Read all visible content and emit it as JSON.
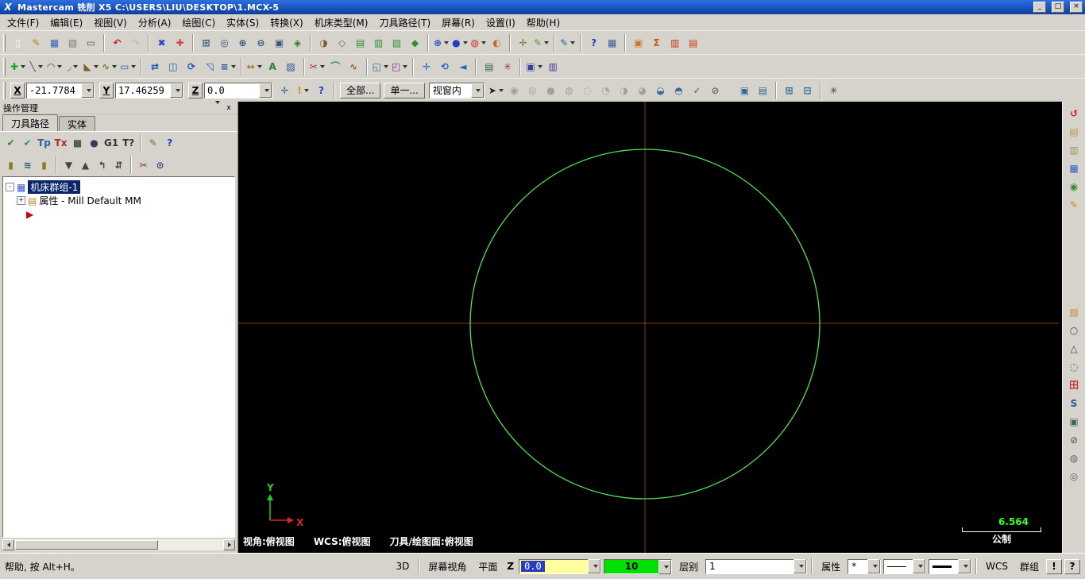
{
  "window": {
    "icon_glyph": "X",
    "title": "Mastercam 铣削 X5  C:\\USERS\\LIU\\DESKTOP\\1.MCX-5",
    "controls": {
      "minimize": "_",
      "maximize": "□",
      "close": "×"
    }
  },
  "menu": {
    "items": [
      "文件(F)",
      "编辑(E)",
      "视图(V)",
      "分析(A)",
      "绘图(C)",
      "实体(S)",
      "转换(X)",
      "机床类型(M)",
      "刀具路径(T)",
      "屏幕(R)",
      "设置(I)",
      "帮助(H)"
    ]
  },
  "toolbar_row1": [
    {
      "n": "new-file",
      "g": "▯",
      "c": "#f8f8f8"
    },
    {
      "n": "sketch",
      "g": "✎",
      "c": "#b8860b"
    },
    {
      "n": "save-file",
      "g": "▦",
      "c": "#2f5fbf"
    },
    {
      "n": "file-merge",
      "g": "▧",
      "c": "#7a7a7a"
    },
    {
      "n": "print",
      "g": "▭",
      "c": "#606060"
    },
    {
      "sep": true
    },
    {
      "n": "undo",
      "g": "↶",
      "c": "#cc2222"
    },
    {
      "n": "redo",
      "g": "↷",
      "c": "#cc8888",
      "x": true
    },
    {
      "sep": true
    },
    {
      "n": "delete-entities",
      "g": "✖",
      "c": "#2244cc"
    },
    {
      "n": "undelete",
      "g": "✚",
      "c": "#cc4444"
    },
    {
      "sep": true
    },
    {
      "n": "zoom-window",
      "g": "⊞",
      "c": "#33557f"
    },
    {
      "n": "zoom-target",
      "g": "◎",
      "c": "#33557f"
    },
    {
      "n": "zoom-in",
      "g": "⊕",
      "c": "#33557f"
    },
    {
      "n": "zoom-out",
      "g": "⊖",
      "c": "#33557f"
    },
    {
      "n": "zoom-fit",
      "g": "▣",
      "c": "#33557f"
    },
    {
      "n": "repaint",
      "g": "◈",
      "c": "#2f7f2f"
    },
    {
      "sep": true
    },
    {
      "n": "gview-shaded",
      "g": "◑",
      "c": "#7f5f2f"
    },
    {
      "n": "gview-wireframe",
      "g": "◇",
      "c": "#7f5f2f"
    },
    {
      "n": "gview-top",
      "g": "▤",
      "c": "#2f8f2f"
    },
    {
      "n": "gview-front",
      "g": "▥",
      "c": "#2f8f2f"
    },
    {
      "n": "gview-side",
      "g": "▨",
      "c": "#2f8f2f"
    },
    {
      "n": "gview-iso",
      "g": "◆",
      "c": "#2f8f2f"
    },
    {
      "sep": true
    },
    {
      "n": "wcs-sphere",
      "g": "⊕",
      "c": "#2255cc",
      "d": true
    },
    {
      "n": "shading-mode",
      "g": "●",
      "c": "#1f3fbf",
      "d": true
    },
    {
      "n": "material-render",
      "g": "◍",
      "c": "#cc3333",
      "d": true
    },
    {
      "n": "translucency",
      "g": "◐",
      "c": "#cc6633"
    },
    {
      "sep": true
    },
    {
      "n": "analyze-position",
      "g": "✛",
      "c": "#8a6a2a"
    },
    {
      "n": "analyze-dynamic",
      "g": "✎",
      "c": "#5a9a2a",
      "d": true
    },
    {
      "sep": true
    },
    {
      "n": "analyze-distance",
      "g": "✎",
      "c": "#2a6a9a",
      "d": true
    },
    {
      "sep": true
    },
    {
      "n": "help",
      "g": "?",
      "c": "#1f3fbf"
    },
    {
      "n": "grid-settings",
      "g": "▦",
      "c": "#3a5a9a"
    },
    {
      "sep": true
    },
    {
      "n": "mcx-convert",
      "g": "▣",
      "c": "#cc7722"
    },
    {
      "n": "summary",
      "g": "Σ",
      "c": "#cc5511"
    },
    {
      "n": "net-collaborate",
      "g": "▥",
      "c": "#cc3311"
    },
    {
      "n": "screen-capture",
      "g": "▤",
      "c": "#cc3311"
    }
  ],
  "toolbar_row2": [
    {
      "n": "create-point",
      "g": "✚",
      "c": "#1f9f1f",
      "d": true
    },
    {
      "n": "create-line",
      "g": "╲",
      "c": "#33557f",
      "d": true
    },
    {
      "n": "create-arc",
      "g": "◠",
      "c": "#7f337f",
      "d": true
    },
    {
      "n": "create-fillet",
      "g": "◞",
      "c": "#2f7f7f",
      "d": true
    },
    {
      "n": "create-chamfer",
      "g": "◣",
      "c": "#7f5f2f",
      "d": true
    },
    {
      "n": "create-spline",
      "g": "∿",
      "c": "#5f7f2f",
      "d": true
    },
    {
      "n": "create-rectangle",
      "g": "▭",
      "c": "#2f5f9f",
      "d": true
    },
    {
      "sep": true
    },
    {
      "n": "xform-translate",
      "g": "⇄",
      "c": "#2255aa"
    },
    {
      "n": "xform-mirror",
      "g": "◫",
      "c": "#2255aa"
    },
    {
      "n": "xform-rotate",
      "g": "⟳",
      "c": "#2255aa"
    },
    {
      "n": "xform-scale",
      "g": "◹",
      "c": "#2255aa"
    },
    {
      "n": "xform-offset",
      "g": "≡",
      "c": "#2255aa",
      "d": true
    },
    {
      "sep": true
    },
    {
      "n": "dimension-smart",
      "g": "↔",
      "c": "#9a7a2a",
      "d": true
    },
    {
      "n": "drafting-note",
      "g": "A",
      "c": "#2f7f2f"
    },
    {
      "n": "hatch",
      "g": "▨",
      "c": "#3a4a9a"
    },
    {
      "sep": true
    },
    {
      "n": "trim-break",
      "g": "✂",
      "c": "#aa3333",
      "d": true
    },
    {
      "n": "join-entities",
      "g": "⌒",
      "c": "#2f8f5f"
    },
    {
      "n": "modify-spline",
      "g": "∿",
      "c": "#8f5f2f"
    },
    {
      "sep": true
    },
    {
      "n": "surface-create",
      "g": "◱",
      "c": "#2f6f8f",
      "d": true
    },
    {
      "n": "solid-extrude",
      "g": "◰",
      "c": "#6f2f8f",
      "d": true
    },
    {
      "sep": true
    },
    {
      "n": "view-pan",
      "g": "✛",
      "c": "#2266cc"
    },
    {
      "n": "view-rotate",
      "g": "⟲",
      "c": "#2266cc"
    },
    {
      "n": "view-previous",
      "g": "◄",
      "c": "#2266cc"
    },
    {
      "sep": true
    },
    {
      "n": "levels-manager",
      "g": "▤",
      "c": "#3a6a3a"
    },
    {
      "n": "attributes-set",
      "g": "✳",
      "c": "#9a3a3a"
    },
    {
      "sep": true
    },
    {
      "n": "machine-group-tools",
      "g": "▣",
      "c": "#3a3a9a",
      "d": true
    },
    {
      "n": "toolpath-editor",
      "g": "▥",
      "c": "#3a3a9a"
    }
  ],
  "coord_bar": {
    "x_label": "X",
    "x_value": "-21.7784",
    "y_label": "Y",
    "y_value": "17.46259",
    "z_label": "Z",
    "z_value": "0.0",
    "icons_mid": [
      {
        "n": "fast-point",
        "g": "✛",
        "c": "#2f5f9f"
      },
      {
        "n": "autocursor-config",
        "g": "!",
        "c": "#cc9900",
        "d": true
      },
      {
        "n": "autocursor-help",
        "g": "?",
        "c": "#1f3fbf"
      }
    ],
    "all_button": "全部...",
    "single_button": "单一...",
    "select-cursor-glyph": "➤",
    "window_combo": "视窗内",
    "icons_select": [
      {
        "n": "general-selection",
        "g": "➤",
        "c": "#222222",
        "d": true
      },
      {
        "n": "quick-mask-points",
        "g": "◉",
        "c": "#555555",
        "x": true
      },
      {
        "n": "quick-mask-lines",
        "g": "◎",
        "c": "#555555",
        "x": true
      },
      {
        "n": "quick-mask-arcs",
        "g": "●",
        "c": "#555555",
        "x": true
      },
      {
        "n": "quick-mask-splines",
        "g": "◍",
        "c": "#555555",
        "x": true
      },
      {
        "n": "quick-mask-surfaces",
        "g": "◌",
        "c": "#555555",
        "x": true
      },
      {
        "n": "quick-mask-solids",
        "g": "◔",
        "c": "#555555",
        "x": true
      },
      {
        "n": "quick-mask-wireframe",
        "g": "◑",
        "c": "#555555",
        "x": true
      },
      {
        "n": "quick-mask-drafting",
        "g": "◕",
        "c": "#555555",
        "x": true
      },
      {
        "n": "quick-mask-color",
        "g": "◒",
        "c": "#3a6a9a"
      },
      {
        "n": "quick-mask-group",
        "g": "◓",
        "c": "#3a6a9a"
      },
      {
        "n": "quick-mask-result",
        "g": "✓",
        "c": "#2f7f2f"
      },
      {
        "n": "quick-mask-clear",
        "g": "⊘",
        "c": "#666666"
      }
    ],
    "icons_right": [
      {
        "n": "display-toolpaths",
        "g": "▣",
        "c": "#2a6a9a"
      },
      {
        "n": "display-wireframe",
        "g": "▤",
        "c": "#2a6a9a"
      },
      {
        "sep": true
      },
      {
        "n": "planes-select",
        "g": "⊞",
        "c": "#2a6a9a"
      },
      {
        "n": "z-depth-select",
        "g": "⊟",
        "c": "#2a6a9a"
      },
      {
        "sep": true
      },
      {
        "n": "axes-toggle",
        "g": "✳",
        "c": "#444444"
      }
    ]
  },
  "ops_manager": {
    "title": "操作管理",
    "tabs": [
      "刀具路径",
      "实体"
    ],
    "toolbar1": [
      {
        "n": "select-all-operations",
        "g": "✔",
        "c": "#2f8f2f"
      },
      {
        "n": "select-all-dirty",
        "g": "✔",
        "c": "#2f8f8f"
      },
      {
        "n": "regen-selected",
        "g": "Tp",
        "c": "#2f5f9f"
      },
      {
        "n": "regen-all-dirty",
        "g": "Tx",
        "c": "#9f2f2f"
      },
      {
        "n": "backplot",
        "g": "■",
        "c": "#5a5a5a"
      },
      {
        "n": "verify",
        "g": "●",
        "c": "#3a3a5a"
      },
      {
        "n": "post-process",
        "g": "G1",
        "c": "#333333"
      },
      {
        "n": "highfeed",
        "g": "T?",
        "c": "#333333"
      },
      {
        "sep": true
      },
      {
        "n": "edit-operations",
        "g": "✎",
        "c": "#8a6a2a"
      },
      {
        "n": "operations-help",
        "g": "?",
        "c": "#1f3fbf"
      }
    ],
    "toolbar2": [
      {
        "n": "lock-operations",
        "g": "▮",
        "c": "#8a7a2a"
      },
      {
        "n": "toggle-toolpath-display",
        "g": "≋",
        "c": "#2a5a8a"
      },
      {
        "n": "lock-posting",
        "g": "▮",
        "c": "#8a7a2a"
      },
      {
        "sep": true
      },
      {
        "n": "move-insert-down",
        "g": "▼",
        "c": "#444444"
      },
      {
        "n": "move-insert-up",
        "g": "▲",
        "c": "#444444"
      },
      {
        "n": "move-insert-arrow",
        "g": "↰",
        "c": "#444444"
      },
      {
        "n": "scroll-insert",
        "g": "⇵",
        "c": "#444444"
      },
      {
        "sep": true
      },
      {
        "n": "only-display-selected",
        "g": "✂",
        "c": "#8a3a3a"
      },
      {
        "n": "screen-toolpaths",
        "g": "⊙",
        "c": "#3a3a8a"
      }
    ],
    "tree": {
      "root_expander": "-",
      "root_label": "机床群组-1",
      "child_expander": "+",
      "child_label": "属性 - Mill Default MM",
      "insert_marker": "▶"
    }
  },
  "viewport": {
    "status": {
      "view": "视角:俯视图",
      "wcs": "WCS:俯视图",
      "cplane": "刀具/绘图面:俯视图"
    },
    "scale": {
      "value": "6.564",
      "unit": "公制"
    },
    "axis": {
      "x_label": "X",
      "y_label": "Y"
    },
    "colors": {
      "background": "#000000",
      "circle": "#55e055",
      "crosshair": "#8a3a12",
      "axis_x": "#dd2222",
      "axis_y": "#22cc22",
      "scale_text": "#33ff33"
    }
  },
  "right_toolbar": [
    {
      "n": "undo-last",
      "g": "↺",
      "c": "#cc2222"
    },
    {
      "n": "clipboard",
      "g": "▤",
      "c": "#b89a4a"
    },
    {
      "n": "notes",
      "g": "▥",
      "c": "#9a9a5a"
    },
    {
      "n": "quick-save",
      "g": "▦",
      "c": "#2f5fbf"
    },
    {
      "n": "gview-cycle",
      "g": "◉",
      "c": "#2f8f2f"
    },
    {
      "n": "sketch-pencil",
      "g": "✎",
      "c": "#cc8822"
    },
    {
      "gap": true
    },
    {
      "n": "palette",
      "g": "▨",
      "c": "#cc8833"
    },
    {
      "n": "circle-tool",
      "g": "○",
      "c": "#444455"
    },
    {
      "n": "polygon-tool",
      "g": "△",
      "c": "#444455"
    },
    {
      "n": "ellipse-tool",
      "g": "◌",
      "c": "#444455"
    },
    {
      "n": "grid-tool",
      "g": "田",
      "c": "#cc3333"
    },
    {
      "n": "spline-tool",
      "g": "S",
      "c": "#2f4f9f"
    },
    {
      "n": "screen-grid",
      "g": "▣",
      "c": "#3a6a5a"
    },
    {
      "n": "disable-tool",
      "g": "⊘",
      "c": "#666666"
    },
    {
      "n": "measure-tool",
      "g": "◍",
      "c": "#666666"
    },
    {
      "n": "blank-entity",
      "g": "◎",
      "c": "#666666"
    }
  ],
  "status_bar": {
    "help_text": "帮助, 按 Alt+H。",
    "btn_3d": "3D",
    "btn_screen_view": "屏幕视角",
    "btn_plane": "平面",
    "z_label": "Z",
    "z_value": "0.0",
    "color_value": "10",
    "color_hex": "#00e000",
    "level_label": "层别",
    "level_value": "1",
    "attr_label": "属性",
    "point_style": "*",
    "wcs_label": "WCS",
    "group_label": "群组",
    "warn_label": "!",
    "qhelp_label": "?"
  }
}
